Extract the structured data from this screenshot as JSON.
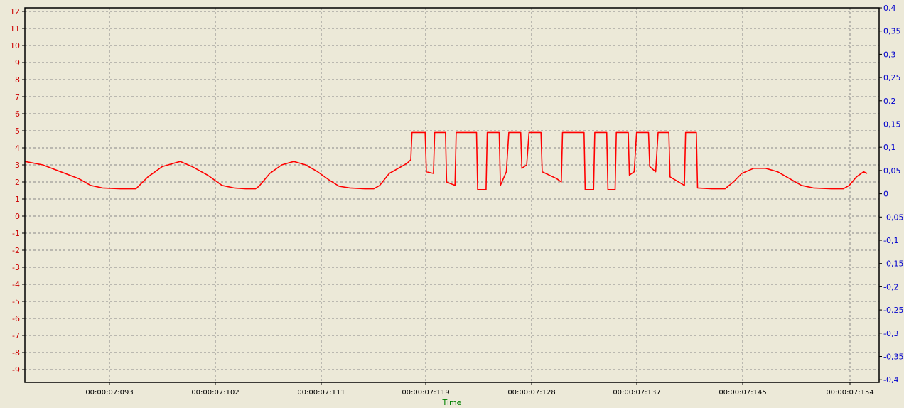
{
  "chart_data": {
    "type": "line",
    "xlabel": "Time",
    "y_left": {
      "ticks": [
        "12",
        "11",
        "10",
        "9",
        "8",
        "7",
        "6",
        "5",
        "4",
        "3",
        "2",
        "1",
        "0",
        "-1",
        "-2",
        "-3",
        "-4",
        "-5",
        "-6",
        "-7",
        "-8",
        "-9"
      ],
      "range": [
        -10,
        12
      ]
    },
    "y_right": {
      "ticks": [
        "0,4",
        "0,35",
        "0,3",
        "0,25",
        "0,2",
        "0,15",
        "0,1",
        "0,05",
        "0",
        "-0,05",
        "-0,1",
        "-0,15",
        "-0,2",
        "-0,25",
        "-0,3",
        "-0,35",
        "-0,4"
      ],
      "range": [
        -0.4,
        0.4
      ]
    },
    "x_ticks": [
      "00:00:07:093",
      "00:00:07:102",
      "00:00:07:111",
      "00:00:07:119",
      "00:00:07:128",
      "00:00:07:137",
      "00:00:07:145",
      "00:00:07:154"
    ],
    "grid": true,
    "colors": {
      "background": "#ece9d8",
      "series": "#ff0000",
      "left_ticks": "#cc0000",
      "right_ticks": "#0000cc",
      "x_ticks": "#000000",
      "xlabel": "#008000"
    },
    "series": [
      {
        "points": [
          [
            0,
            3.2
          ],
          [
            1.5,
            3.0
          ],
          [
            3,
            2.6
          ],
          [
            4.5,
            2.2
          ],
          [
            5.5,
            1.8
          ],
          [
            6.5,
            1.65
          ],
          [
            8,
            1.6
          ],
          [
            9.3,
            1.6
          ],
          [
            10.3,
            2.3
          ],
          [
            11.5,
            2.9
          ],
          [
            13,
            3.2
          ],
          [
            14,
            2.9
          ],
          [
            15.3,
            2.4
          ],
          [
            16.5,
            1.8
          ],
          [
            17.5,
            1.65
          ],
          [
            18.5,
            1.6
          ],
          [
            19.3,
            1.6
          ],
          [
            19.6,
            1.75
          ],
          [
            20.5,
            2.5
          ],
          [
            21.5,
            3.0
          ],
          [
            22.5,
            3.2
          ],
          [
            23.5,
            3.0
          ],
          [
            24.5,
            2.6
          ],
          [
            25.5,
            2.1
          ],
          [
            26.3,
            1.75
          ],
          [
            27.2,
            1.65
          ],
          [
            28.5,
            1.6
          ],
          [
            29.2,
            1.6
          ],
          [
            29.7,
            1.8
          ],
          [
            30.5,
            2.5
          ],
          [
            31.5,
            2.9
          ],
          [
            32,
            3.1
          ],
          [
            32.3,
            3.3
          ],
          [
            32.4,
            4.9
          ],
          [
            33.5,
            4.9
          ],
          [
            33.6,
            2.6
          ],
          [
            34.2,
            2.5
          ],
          [
            34.3,
            4.9
          ],
          [
            35.2,
            4.9
          ],
          [
            35.3,
            2.0
          ],
          [
            36,
            1.8
          ],
          [
            36.1,
            4.9
          ],
          [
            37.8,
            4.9
          ],
          [
            37.9,
            1.55
          ],
          [
            38.6,
            1.55
          ],
          [
            38.7,
            4.9
          ],
          [
            39.7,
            4.9
          ],
          [
            39.8,
            1.8
          ],
          [
            40.3,
            2.6
          ],
          [
            40.5,
            4.9
          ],
          [
            41.5,
            4.9
          ],
          [
            41.6,
            2.8
          ],
          [
            42,
            3.0
          ],
          [
            42.2,
            4.9
          ],
          [
            43.2,
            4.9
          ],
          [
            43.3,
            2.6
          ],
          [
            44.5,
            2.2
          ],
          [
            44.9,
            2.0
          ],
          [
            45,
            4.9
          ],
          [
            46.8,
            4.9
          ],
          [
            46.9,
            1.55
          ],
          [
            47.6,
            1.55
          ],
          [
            47.7,
            4.9
          ],
          [
            48.7,
            4.9
          ],
          [
            48.8,
            1.55
          ],
          [
            49.4,
            1.55
          ],
          [
            49.5,
            4.9
          ],
          [
            50.5,
            4.9
          ],
          [
            50.6,
            2.4
          ],
          [
            51,
            2.6
          ],
          [
            51.2,
            4.9
          ],
          [
            52.2,
            4.9
          ],
          [
            52.3,
            2.9
          ],
          [
            52.8,
            2.6
          ],
          [
            53,
            4.9
          ],
          [
            53.9,
            4.9
          ],
          [
            54,
            2.3
          ],
          [
            55.2,
            1.8
          ],
          [
            55.3,
            4.9
          ],
          [
            56.2,
            4.9
          ],
          [
            56.3,
            1.65
          ],
          [
            57.5,
            1.6
          ],
          [
            58.6,
            1.6
          ],
          [
            59.3,
            2.0
          ],
          [
            60,
            2.5
          ],
          [
            61,
            2.8
          ],
          [
            62,
            2.8
          ],
          [
            63,
            2.6
          ],
          [
            64,
            2.2
          ],
          [
            65,
            1.8
          ],
          [
            66,
            1.65
          ],
          [
            67.5,
            1.6
          ],
          [
            68.5,
            1.6
          ],
          [
            69,
            1.8
          ],
          [
            69.6,
            2.3
          ],
          [
            70.2,
            2.6
          ],
          [
            70.5,
            2.5
          ]
        ]
      }
    ]
  }
}
